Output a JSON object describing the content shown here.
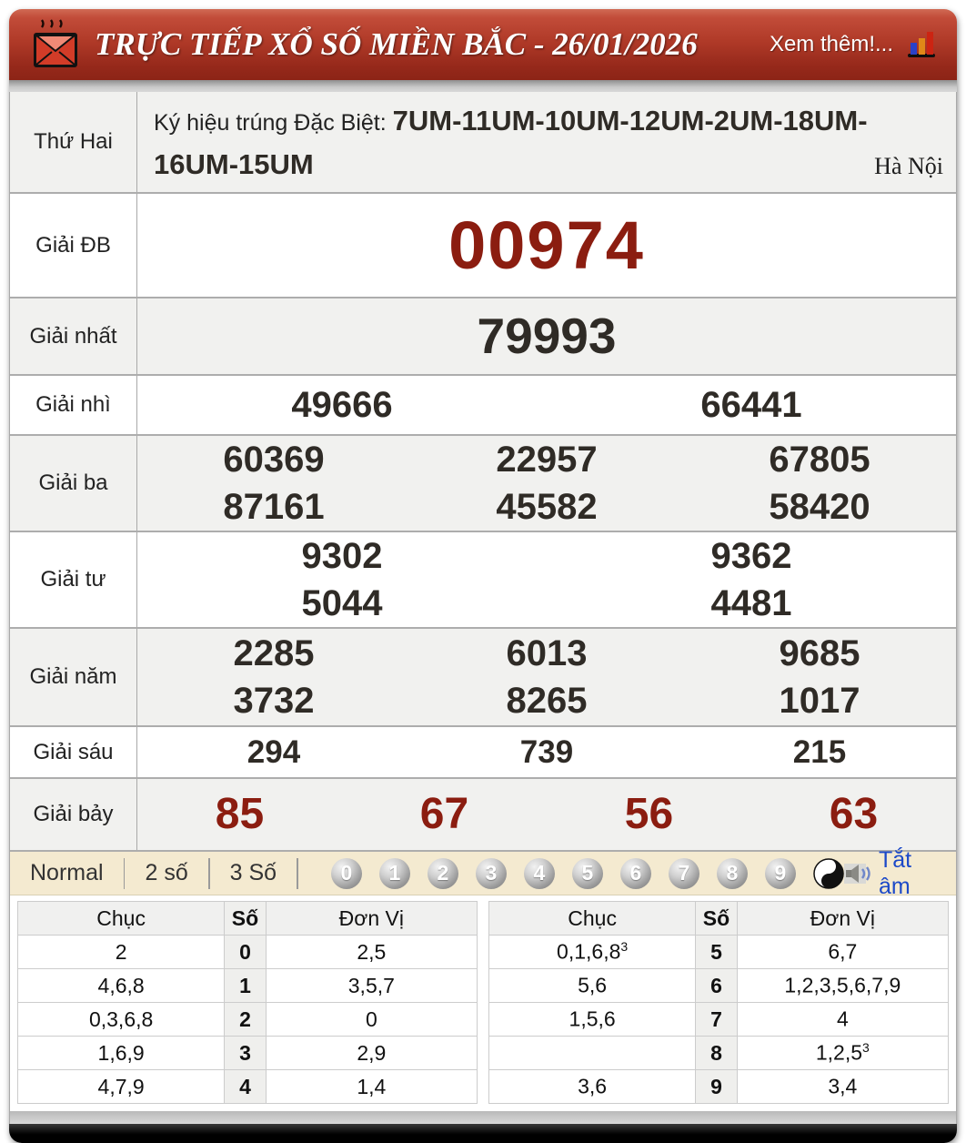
{
  "header": {
    "title": "TRỰC TIẾP XỔ SỐ MIỀN BẮC - 26/01/2026",
    "more_link": "Xem thêm!..."
  },
  "info": {
    "day": "Thứ Hai",
    "symbol_label": "Ký hiệu trúng Đặc Biệt:",
    "symbol_codes": "7UM-11UM-10UM-12UM-2UM-18UM-16UM-15UM",
    "city": "Hà Nội"
  },
  "prizes": {
    "rows": [
      {
        "label": "Giải ĐB",
        "lines": [
          [
            "00974"
          ]
        ]
      },
      {
        "label": "Giải nhất",
        "lines": [
          [
            "79993"
          ]
        ]
      },
      {
        "label": "Giải nhì",
        "lines": [
          [
            "49666",
            "66441"
          ]
        ]
      },
      {
        "label": "Giải ba",
        "lines": [
          [
            "60369",
            "22957",
            "67805"
          ],
          [
            "87161",
            "45582",
            "58420"
          ]
        ]
      },
      {
        "label": "Giải tư",
        "lines": [
          [
            "9302",
            "9362"
          ],
          [
            "5044",
            "4481"
          ]
        ]
      },
      {
        "label": "Giải năm",
        "lines": [
          [
            "2285",
            "6013",
            "9685"
          ],
          [
            "3732",
            "8265",
            "1017"
          ]
        ]
      },
      {
        "label": "Giải sáu",
        "lines": [
          [
            "294",
            "739",
            "215"
          ]
        ]
      },
      {
        "label": "Giải bảy",
        "lines": [
          [
            "85",
            "67",
            "56",
            "63"
          ]
        ]
      }
    ]
  },
  "controls": {
    "modes": [
      "Normal",
      "2 số",
      "3 Số"
    ],
    "balls": [
      "0",
      "1",
      "2",
      "3",
      "4",
      "5",
      "6",
      "7",
      "8",
      "9"
    ],
    "mute_label": "Tắt âm"
  },
  "digit_table": {
    "headers": [
      "Chục",
      "Số",
      "Đơn Vị"
    ],
    "left_rows": [
      {
        "chuc": "2",
        "so": "0",
        "donvi": "2,5"
      },
      {
        "chuc": "4,6,8",
        "so": "1",
        "donvi": "3,5,7"
      },
      {
        "chuc": "0,3,6,8",
        "so": "2",
        "donvi": "0"
      },
      {
        "chuc": "1,6,9",
        "so": "3",
        "donvi": "2,9"
      },
      {
        "chuc": "4,7,9",
        "so": "4",
        "donvi": "1,4"
      }
    ],
    "right_rows": [
      {
        "chuc": "0,1,6,8",
        "chuc_sup": "3",
        "so": "5",
        "donvi": "6,7"
      },
      {
        "chuc": "5,6",
        "so": "6",
        "donvi": "1,2,3,5,6,7,9"
      },
      {
        "chuc": "1,5,6",
        "so": "7",
        "donvi": "4"
      },
      {
        "chuc": "",
        "so": "8",
        "donvi": "1,2,5",
        "donvi_sup": "3"
      },
      {
        "chuc": "3,6",
        "so": "9",
        "donvi": "3,4"
      }
    ]
  },
  "colors": {
    "accent_red": "#8b1d10",
    "header_red": "#a33522",
    "link_blue": "#1c49c8",
    "bar_beige": "#f4ead0"
  }
}
